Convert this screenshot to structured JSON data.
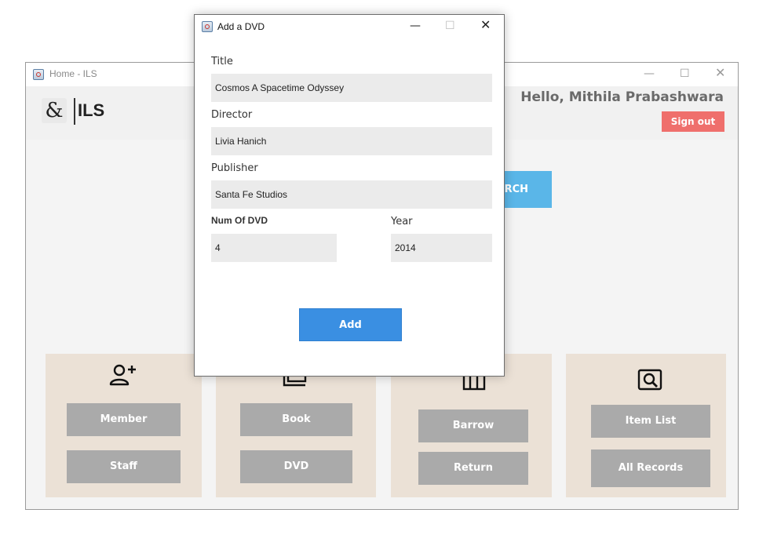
{
  "main_window": {
    "title": "Home - ILS",
    "logo_text": "ILS",
    "greeting": "Hello, Mithila Prabashwara",
    "signout_label": "Sign out",
    "search_label_fragment": "RCH",
    "panels": [
      {
        "icon": "add-user-icon",
        "buttons": [
          "Member",
          "Staff"
        ]
      },
      {
        "icon": "book-stack-icon",
        "buttons": [
          "Book",
          "DVD"
        ]
      },
      {
        "icon": "shelf-icon",
        "buttons": [
          "Barrow",
          "Return"
        ]
      },
      {
        "icon": "search-item-icon",
        "buttons": [
          "Item List",
          "All Records"
        ]
      }
    ]
  },
  "dialog": {
    "title": "Add a DVD",
    "fields": {
      "title_label": "Title",
      "title_value": "Cosmos  A Spacetime Odyssey",
      "director_label": "Director",
      "director_value": "Livia Hanich",
      "publisher_label": "Publisher",
      "publisher_value": "Santa Fe Studios",
      "num_label": "Num Of DVD",
      "num_value": "4",
      "year_label": "Year",
      "year_value": "2014"
    },
    "add_label": "Add"
  },
  "colors": {
    "signout": "#ef6f6c",
    "search": "#5ab6e8",
    "add": "#3a8fe2",
    "panel": "#ebe1d6",
    "gray_button": "#aaaaaa"
  }
}
